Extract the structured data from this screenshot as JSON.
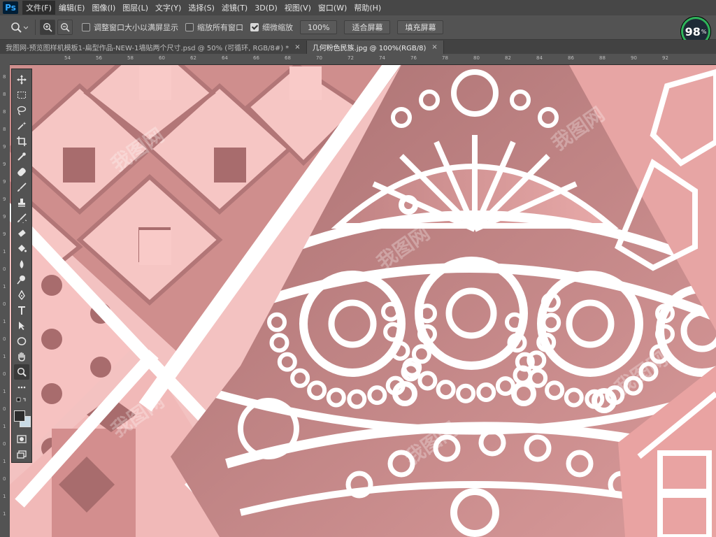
{
  "app": {
    "logo": "Ps"
  },
  "menu": [
    "文件(F)",
    "编辑(E)",
    "图像(I)",
    "图层(L)",
    "文字(Y)",
    "选择(S)",
    "滤镜(T)",
    "3D(D)",
    "视图(V)",
    "窗口(W)",
    "帮助(H)"
  ],
  "options": {
    "resize_windows": "调整窗口大小以满屏显示",
    "zoom_all_windows": "缩放所有窗口",
    "scrubby_zoom": "细微缩放",
    "zoom_value": "100%",
    "fit_screen": "适合屏幕",
    "fill_screen": "填充屏幕",
    "resize_checked": false,
    "zoom_all_checked": false,
    "scrubby_checked": true
  },
  "gauge": {
    "value": "98",
    "unit": "%"
  },
  "tabs": [
    {
      "label": "我图网-预览图样机模板1-扁型作品-NEW-1墙贴两个尺寸.psd @ 50% (可循环, RGB/8#) *",
      "close": "×",
      "active": false
    },
    {
      "label": "几何粉色民族.jpg @ 100%(RGB/8)",
      "close": "×",
      "active": true
    }
  ],
  "ruler_top": [
    "54",
    "56",
    "58",
    "60",
    "62",
    "64",
    "66",
    "68",
    "70",
    "72",
    "74",
    "76",
    "78",
    "80",
    "82",
    "84",
    "86",
    "88",
    "90",
    "92"
  ],
  "ruler_left": [
    "8",
    "8",
    "8",
    "8",
    "9",
    "9",
    "9",
    "9",
    "9",
    "9",
    "1",
    "0",
    "1",
    "0",
    "1",
    "0",
    "1",
    "0",
    "1",
    "0",
    "1",
    "0",
    "1",
    "0",
    "1",
    "1"
  ],
  "tools": [
    "move-icon",
    "marquee-icon",
    "lasso-icon",
    "magic-wand-icon",
    "crop-icon",
    "eyedropper-icon",
    "healing-icon",
    "brush-icon",
    "stamp-icon",
    "history-brush-icon",
    "eraser-icon",
    "paint-bucket-icon",
    "blur-icon",
    "dodge-icon",
    "pen-icon",
    "type-icon",
    "path-select-icon",
    "ellipse-icon",
    "hand-icon",
    "zoom-icon",
    "more-icon"
  ],
  "colors": {
    "foreground": "#2c2c2c",
    "background": "#c9dbe6",
    "accent_pink": "#b87f7f"
  },
  "watermark": "我图网"
}
